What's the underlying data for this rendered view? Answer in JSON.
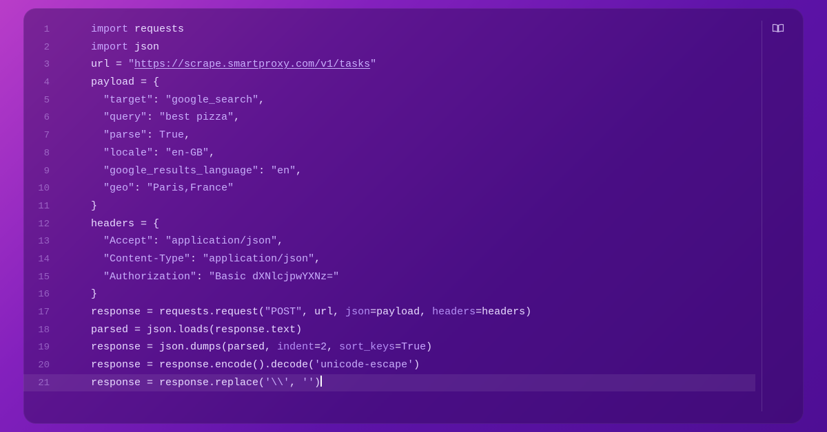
{
  "editor": {
    "lines": [
      {
        "n": 1,
        "indent": "    ",
        "tokens": [
          [
            "kw",
            "import "
          ],
          [
            "pl",
            "requests"
          ]
        ]
      },
      {
        "n": 2,
        "indent": "    ",
        "tokens": [
          [
            "kw",
            "import "
          ],
          [
            "pl",
            "json"
          ]
        ]
      },
      {
        "n": 3,
        "indent": "    ",
        "tokens": [
          [
            "pl",
            "url = "
          ],
          [
            "str",
            "\""
          ],
          [
            "url",
            "https://scrape.smartproxy.com/v1/tasks"
          ],
          [
            "str",
            "\""
          ]
        ]
      },
      {
        "n": 4,
        "indent": "    ",
        "tokens": [
          [
            "pl",
            "payload = {"
          ]
        ]
      },
      {
        "n": 5,
        "indent": "      ",
        "tokens": [
          [
            "str",
            "\"target\""
          ],
          [
            "pl",
            ": "
          ],
          [
            "str",
            "\"google_search\""
          ],
          [
            "pl",
            ","
          ]
        ]
      },
      {
        "n": 6,
        "indent": "      ",
        "tokens": [
          [
            "str",
            "\"query\""
          ],
          [
            "pl",
            ": "
          ],
          [
            "str",
            "\"best pizza\""
          ],
          [
            "pl",
            ","
          ]
        ]
      },
      {
        "n": 7,
        "indent": "      ",
        "tokens": [
          [
            "str",
            "\"parse\""
          ],
          [
            "pl",
            ": "
          ],
          [
            "kw",
            "True"
          ],
          [
            "pl",
            ","
          ]
        ]
      },
      {
        "n": 8,
        "indent": "      ",
        "tokens": [
          [
            "str",
            "\"locale\""
          ],
          [
            "pl",
            ": "
          ],
          [
            "str",
            "\"en-GB\""
          ],
          [
            "pl",
            ","
          ]
        ]
      },
      {
        "n": 9,
        "indent": "      ",
        "tokens": [
          [
            "str",
            "\"google_results_language\""
          ],
          [
            "pl",
            ": "
          ],
          [
            "str",
            "\"en\""
          ],
          [
            "pl",
            ","
          ]
        ]
      },
      {
        "n": 10,
        "indent": "      ",
        "tokens": [
          [
            "str",
            "\"geo\""
          ],
          [
            "pl",
            ": "
          ],
          [
            "str",
            "\"Paris,France\""
          ]
        ]
      },
      {
        "n": 11,
        "indent": "    ",
        "tokens": [
          [
            "pl",
            "}"
          ]
        ]
      },
      {
        "n": 12,
        "indent": "    ",
        "tokens": [
          [
            "pl",
            "headers = {"
          ]
        ]
      },
      {
        "n": 13,
        "indent": "      ",
        "tokens": [
          [
            "str",
            "\"Accept\""
          ],
          [
            "pl",
            ": "
          ],
          [
            "str",
            "\"application/json\""
          ],
          [
            "pl",
            ","
          ]
        ]
      },
      {
        "n": 14,
        "indent": "      ",
        "tokens": [
          [
            "str",
            "\"Content-Type\""
          ],
          [
            "pl",
            ": "
          ],
          [
            "str",
            "\"application/json\""
          ],
          [
            "pl",
            ","
          ]
        ]
      },
      {
        "n": 15,
        "indent": "      ",
        "tokens": [
          [
            "str",
            "\"Authorization\""
          ],
          [
            "pl",
            ": "
          ],
          [
            "str",
            "\"Basic dXNlcjpwYXNz=\""
          ]
        ]
      },
      {
        "n": 16,
        "indent": "    ",
        "tokens": [
          [
            "pl",
            "}"
          ]
        ]
      },
      {
        "n": 17,
        "indent": "    ",
        "tokens": [
          [
            "pl",
            "response = requests.request("
          ],
          [
            "str",
            "\"POST\""
          ],
          [
            "pl",
            ", url, "
          ],
          [
            "arg",
            "json"
          ],
          [
            "pl",
            "=payload, "
          ],
          [
            "arg",
            "headers"
          ],
          [
            "pl",
            "=headers)"
          ]
        ]
      },
      {
        "n": 18,
        "indent": "    ",
        "tokens": [
          [
            "pl",
            "parsed = json.loads(response.text)"
          ]
        ]
      },
      {
        "n": 19,
        "indent": "    ",
        "tokens": [
          [
            "pl",
            "response = json.dumps(parsed, "
          ],
          [
            "arg",
            "indent"
          ],
          [
            "pl",
            "="
          ],
          [
            "num",
            "2"
          ],
          [
            "pl",
            ", "
          ],
          [
            "arg",
            "sort_keys"
          ],
          [
            "pl",
            "="
          ],
          [
            "kw",
            "True"
          ],
          [
            "pl",
            ")"
          ]
        ]
      },
      {
        "n": 20,
        "indent": "    ",
        "tokens": [
          [
            "pl",
            "response = response.encode().decode("
          ],
          [
            "str",
            "'unicode-escape'"
          ],
          [
            "pl",
            ")"
          ]
        ]
      },
      {
        "n": 21,
        "indent": "    ",
        "tokens": [
          [
            "pl",
            "response = response.replace("
          ],
          [
            "str",
            "'\\\\'"
          ],
          [
            "pl",
            ", "
          ],
          [
            "str",
            "''"
          ],
          [
            "pl",
            ")"
          ]
        ],
        "cursor": true,
        "highlight": true
      }
    ]
  }
}
